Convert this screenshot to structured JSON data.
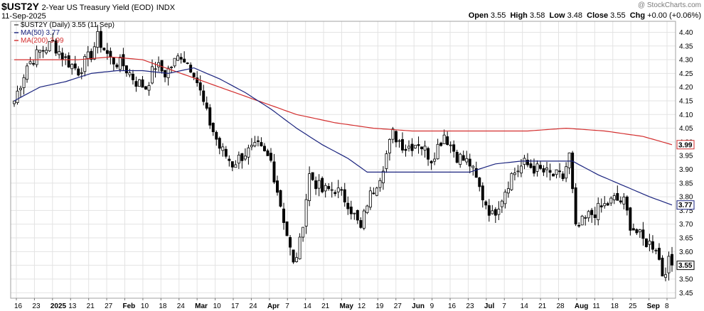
{
  "header": {
    "symbol": "$UST2Y",
    "description": "2-Year US Treasury Yield (EOD)",
    "exchange": "INDX",
    "date": "11-Sep-2025",
    "watermark": "@ StockCharts.com",
    "open_label": "Open",
    "open": "3.55",
    "high_label": "High",
    "high": "3.58",
    "low_label": "Low",
    "low": "3.48",
    "close_label": "Close",
    "close": "3.55",
    "chg_label": "Chg",
    "chg": "+0.00 (+0.06%)"
  },
  "legend": {
    "price": "$UST2Y (Daily) 3.55 (11 Sep)",
    "ma50": "MA(50) 3.77",
    "ma200": "MA(200) 3.99"
  },
  "colors": {
    "candle": "#000000",
    "ma50": "#1a237e",
    "ma200": "#d32f2f",
    "grid": "#e3e3e3",
    "plot_border": "#a0a0a0"
  },
  "chart_data": {
    "type": "candlestick",
    "y_axis": {
      "side": "right",
      "ylim": [
        3.43,
        4.44
      ],
      "ticks": [
        "4.40",
        "4.35",
        "4.30",
        "4.25",
        "4.20",
        "4.15",
        "4.10",
        "4.05",
        "4.00",
        "3.95",
        "3.90",
        "3.85",
        "3.80",
        "3.75",
        "3.70",
        "3.65",
        "3.60",
        "3.55",
        "3.50",
        "3.45"
      ],
      "value_tags": [
        {
          "label": "3.99",
          "value": 3.99,
          "color": "#d32f2f"
        },
        {
          "label": "3.77",
          "value": 3.77,
          "color": "#1a237e"
        },
        {
          "label": "3.55",
          "value": 3.55,
          "color": "#000000"
        }
      ]
    },
    "x_axis": {
      "labels": [
        "16",
        "23",
        "2025",
        "13",
        "21",
        "27",
        "Feb",
        "10",
        "18",
        "24",
        "Mar",
        "10",
        "17",
        "24",
        "Apr",
        "7",
        "14",
        "21",
        "May",
        "12",
        "19",
        "27",
        "Jun",
        "9",
        "16",
        "23",
        "Jul",
        "7",
        "14",
        "21",
        "28",
        "Aug",
        "11",
        "18",
        "25",
        "Sep",
        "8"
      ],
      "bold": [
        "2025",
        "Feb",
        "Mar",
        "Apr",
        "May",
        "Jun",
        "Jul",
        "Aug",
        "Sep"
      ]
    },
    "grid": true,
    "legend_position": "top-left",
    "anchors": [
      [
        0,
        4.15
      ],
      [
        4,
        4.28
      ],
      [
        8,
        4.33
      ],
      [
        12,
        4.36
      ],
      [
        16,
        4.3
      ],
      [
        20,
        4.26
      ],
      [
        24,
        4.32
      ],
      [
        26,
        4.38
      ],
      [
        30,
        4.3
      ],
      [
        34,
        4.28
      ],
      [
        38,
        4.22
      ],
      [
        41,
        4.2
      ],
      [
        44,
        4.28
      ],
      [
        47,
        4.25
      ],
      [
        52,
        4.32
      ],
      [
        56,
        4.26
      ],
      [
        60,
        4.1
      ],
      [
        64,
        3.98
      ],
      [
        68,
        3.92
      ],
      [
        72,
        3.96
      ],
      [
        76,
        3.98
      ],
      [
        80,
        3.93
      ],
      [
        84,
        3.72
      ],
      [
        87,
        3.55
      ],
      [
        89,
        3.63
      ],
      [
        92,
        3.88
      ],
      [
        96,
        3.82
      ],
      [
        100,
        3.83
      ],
      [
        104,
        3.78
      ],
      [
        108,
        3.68
      ],
      [
        110,
        3.78
      ],
      [
        114,
        3.88
      ],
      [
        118,
        4.03
      ],
      [
        122,
        3.98
      ],
      [
        126,
        4.0
      ],
      [
        130,
        3.94
      ],
      [
        134,
        4.03
      ],
      [
        138,
        3.95
      ],
      [
        142,
        3.92
      ],
      [
        146,
        3.8
      ],
      [
        149,
        3.73
      ],
      [
        152,
        3.8
      ],
      [
        155,
        3.88
      ],
      [
        159,
        3.92
      ],
      [
        163,
        3.9
      ],
      [
        167,
        3.88
      ],
      [
        171,
        3.87
      ],
      [
        173,
        3.95
      ],
      [
        175,
        3.68
      ],
      [
        179,
        3.73
      ],
      [
        183,
        3.76
      ],
      [
        187,
        3.79
      ],
      [
        190,
        3.78
      ],
      [
        192,
        3.7
      ],
      [
        196,
        3.64
      ],
      [
        200,
        3.62
      ],
      [
        202,
        3.52
      ],
      [
        204,
        3.56
      ],
      [
        205,
        3.55
      ]
    ],
    "ma50_points": [
      [
        0,
        4.15
      ],
      [
        8,
        4.2
      ],
      [
        16,
        4.22
      ],
      [
        24,
        4.25
      ],
      [
        32,
        4.26
      ],
      [
        40,
        4.26
      ],
      [
        48,
        4.25
      ],
      [
        56,
        4.27
      ],
      [
        64,
        4.23
      ],
      [
        72,
        4.18
      ],
      [
        80,
        4.12
      ],
      [
        88,
        4.05
      ],
      [
        96,
        3.99
      ],
      [
        104,
        3.94
      ],
      [
        110,
        3.89
      ],
      [
        118,
        3.89
      ],
      [
        126,
        3.89
      ],
      [
        134,
        3.89
      ],
      [
        142,
        3.89
      ],
      [
        150,
        3.92
      ],
      [
        158,
        3.93
      ],
      [
        166,
        3.93
      ],
      [
        174,
        3.93
      ],
      [
        182,
        3.88
      ],
      [
        190,
        3.84
      ],
      [
        198,
        3.8
      ],
      [
        205,
        3.77
      ]
    ],
    "ma200_points": [
      [
        0,
        4.3
      ],
      [
        20,
        4.3
      ],
      [
        30,
        4.31
      ],
      [
        40,
        4.3
      ],
      [
        52,
        4.25
      ],
      [
        64,
        4.2
      ],
      [
        76,
        4.15
      ],
      [
        88,
        4.1
      ],
      [
        100,
        4.07
      ],
      [
        112,
        4.05
      ],
      [
        124,
        4.04
      ],
      [
        136,
        4.04
      ],
      [
        148,
        4.04
      ],
      [
        160,
        4.04
      ],
      [
        172,
        4.05
      ],
      [
        184,
        4.04
      ],
      [
        196,
        4.02
      ],
      [
        205,
        3.99
      ]
    ]
  }
}
